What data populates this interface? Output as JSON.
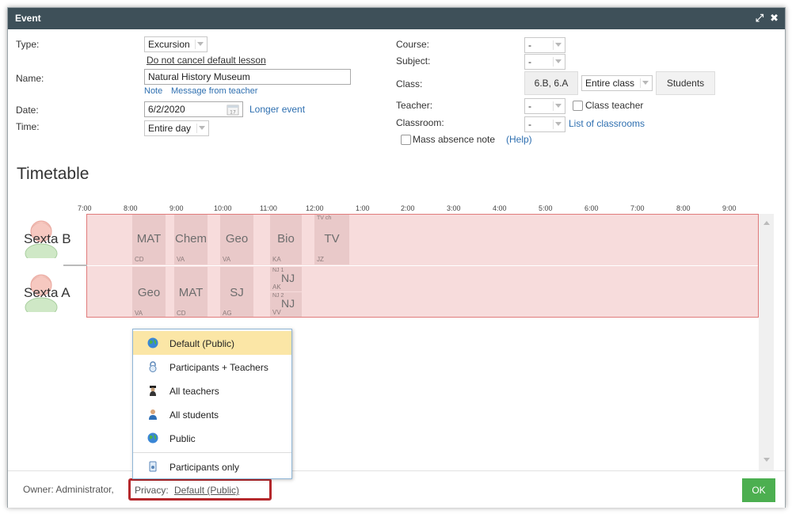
{
  "dialog": {
    "title": "Event"
  },
  "form": {
    "type_label": "Type:",
    "type_value": "Excursion",
    "dont_cancel_link": "Do not cancel default lesson",
    "name_label": "Name:",
    "name_value": "Natural History Museum",
    "note_link": "Note",
    "message_link": "Message from teacher",
    "date_label": "Date:",
    "date_value": "6/2/2020",
    "calendar_day": "17",
    "longer_event_link": "Longer event",
    "time_label": "Time:",
    "time_value": "Entire day",
    "course_label": "Course:",
    "course_value": "-",
    "subject_label": "Subject:",
    "subject_value": "-",
    "class_label": "Class:",
    "class_value": "6.B, 6.A",
    "class_scope": "Entire class",
    "students_button": "Students",
    "teacher_label": "Teacher:",
    "teacher_value": "-",
    "class_teacher_label": "Class teacher",
    "classroom_label": "Classroom:",
    "classroom_value": "-",
    "list_classrooms_link": "List of classrooms",
    "mass_absence_label": "Mass absence note",
    "help_link": "(Help)"
  },
  "timetable": {
    "title": "Timetable",
    "hours": [
      "7:00",
      "8:00",
      "9:00",
      "10:00",
      "11:00",
      "12:00",
      "1:00",
      "2:00",
      "3:00",
      "4:00",
      "5:00",
      "6:00",
      "7:00",
      "8:00",
      "9:00"
    ],
    "rows": [
      {
        "name": "Sexta B",
        "lessons": [
          {
            "subject": "MAT",
            "teacher": "CD"
          },
          {
            "subject": "Chem",
            "teacher": "VA"
          },
          {
            "subject": "Geo",
            "teacher": "VA"
          },
          {
            "subject": "Bio",
            "teacher": "KA"
          },
          {
            "subject": "TV",
            "teacher": "JZ",
            "top": "TV ch"
          }
        ]
      },
      {
        "name": "Sexta A",
        "lessons": [
          {
            "subject": "Geo",
            "teacher": "VA"
          },
          {
            "subject": "MAT",
            "teacher": "CD"
          },
          {
            "subject": "SJ",
            "teacher": "AG"
          },
          {
            "subject": "NJ",
            "teacher": "AK",
            "top": "NJ 1"
          },
          {
            "subject": "NJ",
            "teacher": "VV",
            "top": "NJ 2"
          }
        ]
      }
    ]
  },
  "privacy_menu": {
    "items": [
      {
        "label": "Default (Public)",
        "icon": "globe-icon",
        "selected": true
      },
      {
        "label": "Participants + Teachers",
        "icon": "lock-icon"
      },
      {
        "label": "All teachers",
        "icon": "teacher-icon"
      },
      {
        "label": "All students",
        "icon": "student-icon"
      },
      {
        "label": "Public",
        "icon": "globe-icon"
      },
      {
        "label": "Participants only",
        "icon": "participants-icon"
      }
    ]
  },
  "footer": {
    "owner_text": "Owner: Administrator,",
    "privacy_label": "Privacy:",
    "privacy_value": "Default (Public)",
    "ok_button": "OK"
  },
  "colors": {
    "titlebar": "#3e5059",
    "band": "#f7dcdc",
    "band_border": "#e07b7b",
    "ok": "#4caf50",
    "highlight": "#b5282c",
    "menu_selected": "#fbe6a6"
  }
}
